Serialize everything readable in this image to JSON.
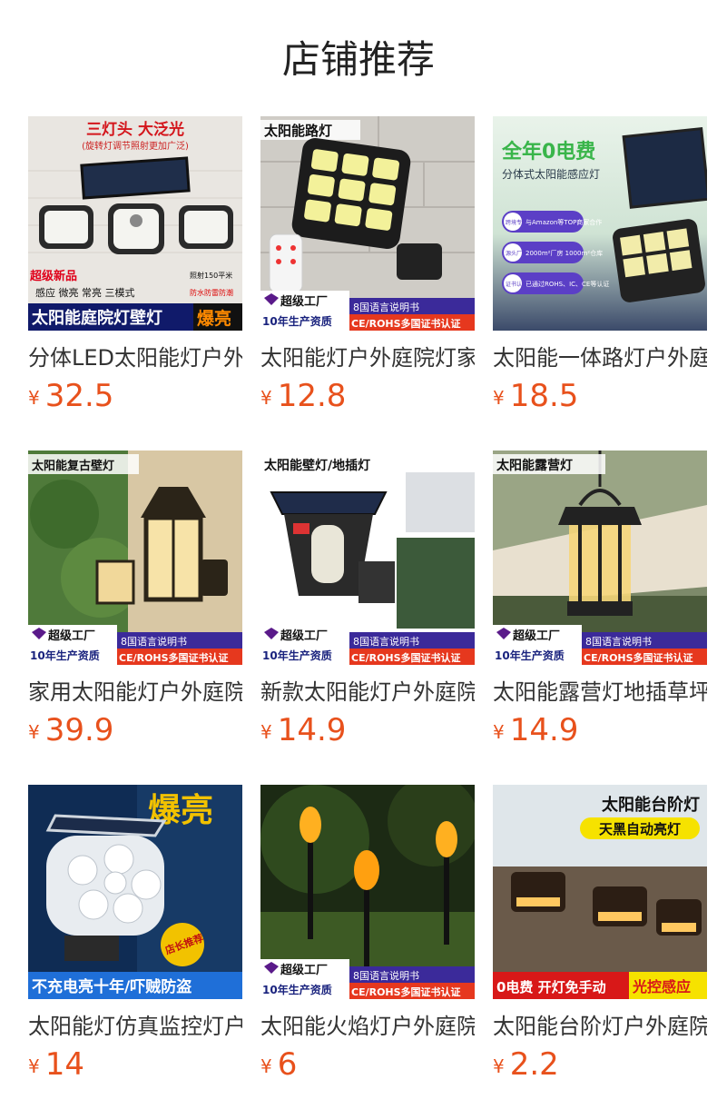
{
  "header": {
    "title": "店铺推荐"
  },
  "products": [
    {
      "name": "分体LED太阳能灯户外庭院灯",
      "currency": "¥",
      "price": "32.5",
      "badges": [
        "三灯头 大泛光",
        "(旋转灯调节照射更加广泛)",
        "超级新品",
        "感应 微亮 常亮 三模式",
        "照射150平米",
        "防水防雷防潮",
        "太阳能庭院灯壁灯",
        "爆亮"
      ]
    },
    {
      "name": "太阳能灯户外庭院灯家用",
      "currency": "¥",
      "price": "12.8",
      "badges": [
        "太阳能路灯",
        "超级工厂",
        "10年生产资质",
        "8国语言说明书",
        "CE/ROHS多国证书认证"
      ]
    },
    {
      "name": "太阳能一体路灯户外庭院",
      "currency": "¥",
      "price": "18.5",
      "badges": [
        "全年0电费",
        "分体式太阳能感应灯",
        "跨境专供",
        "与Amazon等TOP商家合作",
        "源头厂家",
        "2000m²厂房 1000m²仓库",
        "证书认证",
        "已通过ROHS、IC、CE等认证"
      ]
    },
    {
      "name": "家用太阳能灯户外庭院壁灯",
      "currency": "¥",
      "price": "39.9",
      "badges": [
        "太阳能复古壁灯",
        "超级工厂",
        "10年生产资质",
        "8国语言说明书",
        "CE/ROHS多国证书认证"
      ]
    },
    {
      "name": "新款太阳能灯户外庭院灯",
      "currency": "¥",
      "price": "14.9",
      "badges": [
        "太阳能壁灯/地插灯",
        "超级工厂",
        "10年生产资质",
        "8国语言说明书",
        "CE/ROHS多国证书认证"
      ]
    },
    {
      "name": "太阳能露营灯地插草坪灯",
      "currency": "¥",
      "price": "14.9",
      "badges": [
        "太阳能露营灯",
        "超级工厂",
        "10年生产资质",
        "8国语言说明书",
        "CE/ROHS多国证书认证"
      ]
    },
    {
      "name": "太阳能灯仿真监控灯户外",
      "currency": "¥",
      "price": "14",
      "badges": [
        "爆亮",
        "店长推荐",
        "不充电亮十年/吓贼防盗"
      ]
    },
    {
      "name": "太阳能火焰灯户外庭院灯",
      "currency": "¥",
      "price": "6",
      "badges": [
        "超级工厂",
        "10年生产资质",
        "8国语言说明书",
        "CE/ROHS多国证书认证"
      ]
    },
    {
      "name": "太阳能台阶灯户外庭院灯",
      "currency": "¥",
      "price": "2.2",
      "badges": [
        "太阳能台阶灯",
        "天黑自动亮灯",
        "0电费 开灯免手动",
        "光控感应"
      ]
    }
  ]
}
